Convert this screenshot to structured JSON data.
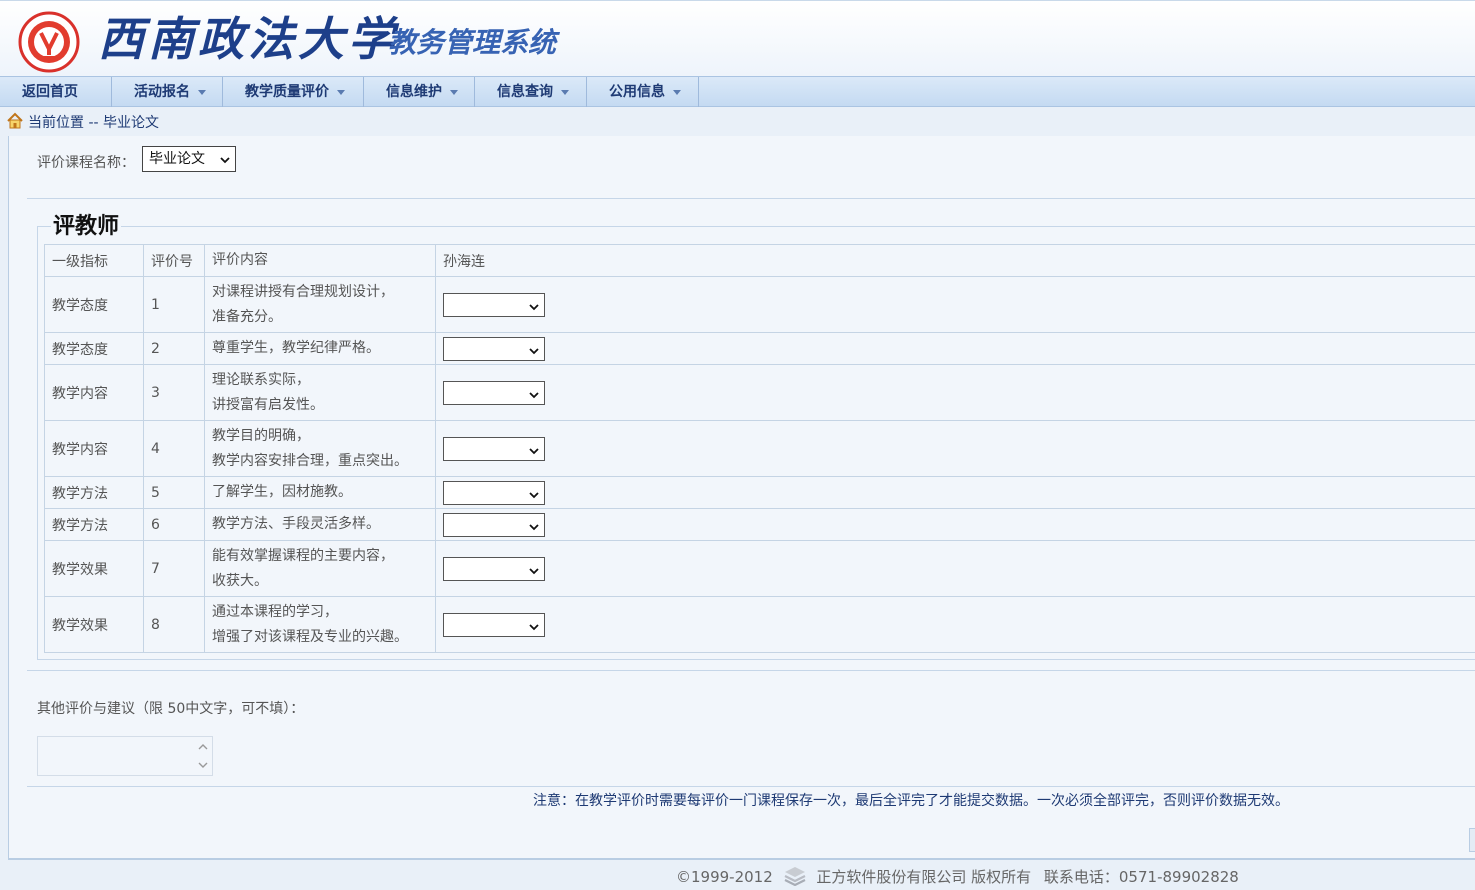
{
  "header": {
    "university_name": "西南政法大学",
    "system_name": "教务管理系统",
    "seal_icon": "university-seal-icon"
  },
  "nav": {
    "items": [
      {
        "label": "返回首页",
        "has_dropdown": false
      },
      {
        "label": "活动报名",
        "has_dropdown": true
      },
      {
        "label": "教学质量评价",
        "has_dropdown": true
      },
      {
        "label": "信息维护",
        "has_dropdown": true
      },
      {
        "label": "信息查询",
        "has_dropdown": true
      },
      {
        "label": "公用信息",
        "has_dropdown": true
      }
    ]
  },
  "breadcrumb": {
    "prefix": "当前位置 -- ",
    "current": "毕业论文",
    "icon": "home-icon"
  },
  "course": {
    "label": "评价课程名称：",
    "selected": "毕业论文"
  },
  "section": {
    "title": "评教师"
  },
  "table": {
    "headers": [
      "一级指标",
      "评价号",
      "评价内容",
      "孙海连"
    ],
    "rows": [
      {
        "category": "教学态度",
        "num": "1",
        "content_line1": "对课程讲授有合理规划设计，",
        "content_line2": "准备充分。",
        "rating": ""
      },
      {
        "category": "教学态度",
        "num": "2",
        "content_line1": "尊重学生，教学纪律严格。",
        "content_line2": "",
        "rating": ""
      },
      {
        "category": "教学内容",
        "num": "3",
        "content_line1": "理论联系实际，",
        "content_line2": "讲授富有启发性。",
        "rating": ""
      },
      {
        "category": "教学内容",
        "num": "4",
        "content_line1": "教学目的明确，",
        "content_line2": "教学内容安排合理，重点突出。",
        "rating": ""
      },
      {
        "category": "教学方法",
        "num": "5",
        "content_line1": "了解学生，因材施教。",
        "content_line2": "",
        "rating": ""
      },
      {
        "category": "教学方法",
        "num": "6",
        "content_line1": "教学方法、手段灵活多样。",
        "content_line2": "",
        "rating": ""
      },
      {
        "category": "教学效果",
        "num": "7",
        "content_line1": "能有效掌握课程的主要内容，",
        "content_line2": "收获大。",
        "rating": ""
      },
      {
        "category": "教学效果",
        "num": "8",
        "content_line1": "通过本课程的学习，",
        "content_line2": "增强了对该课程及专业的兴趣。",
        "rating": ""
      }
    ]
  },
  "suggestion": {
    "label": "其他评价与建议（限 50中文字，可不填）：",
    "value": ""
  },
  "note": "注意：在教学评价时需要每评价一门课程保存一次，最后全评完了才能提交数据。一次必须全部评完，否则评价数据无效。",
  "footer": {
    "copyright": "©1999-2012",
    "company": "正方软件股份有限公司 版权所有",
    "phone": "联系电话：0571-89902828"
  }
}
